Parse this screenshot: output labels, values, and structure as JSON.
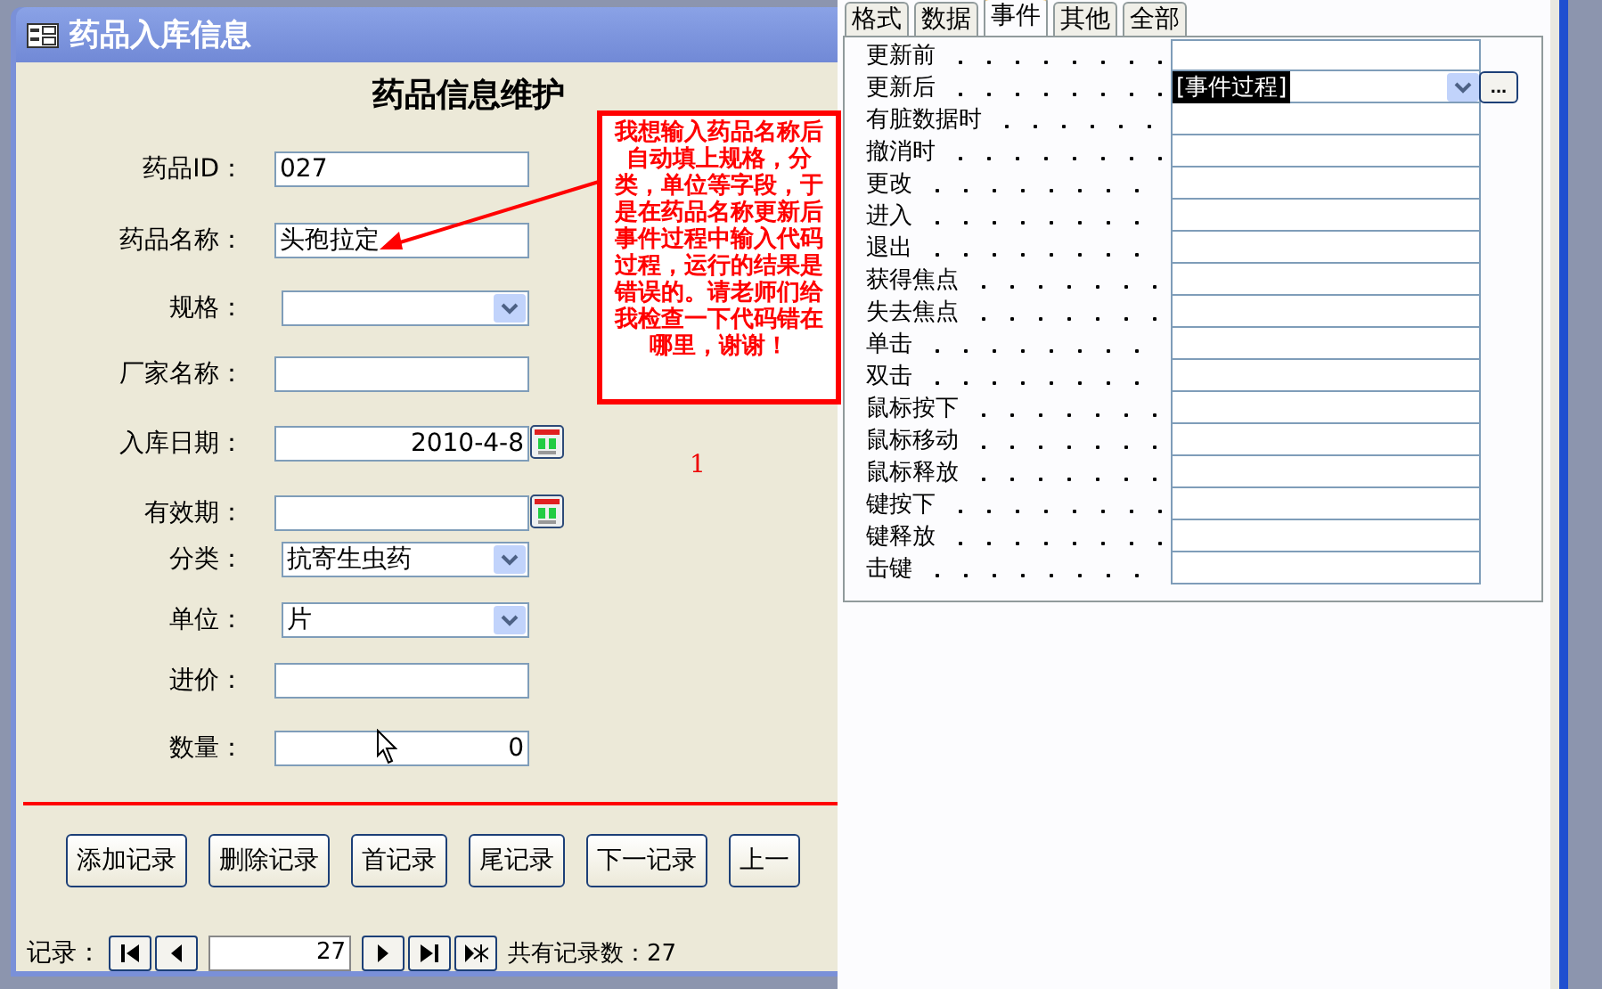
{
  "form_window": {
    "title": "药品入库信息",
    "heading": "药品信息维护",
    "fields": [
      {
        "label": "药品ID：",
        "kind": "text",
        "value": "027"
      },
      {
        "label": "药品名称：",
        "kind": "text",
        "value": "头孢拉定"
      },
      {
        "label": "规格：",
        "kind": "combo"
      },
      {
        "label": "厂家名称：",
        "kind": "text"
      },
      {
        "label": "入库日期：",
        "kind": "date",
        "value": "2010-4-8"
      },
      {
        "label": "有效期：",
        "kind": "date"
      },
      {
        "label": "分类：",
        "kind": "combo",
        "value": "抗寄生虫药"
      },
      {
        "label": "单位：",
        "kind": "combo",
        "value": "片"
      },
      {
        "label": "进价：",
        "kind": "text"
      },
      {
        "label": "数量：",
        "kind": "number",
        "value": "0"
      }
    ],
    "marker": "1",
    "buttons": [
      "添加记录",
      "删除记录",
      "首记录",
      "尾记录",
      "下一记录",
      "上一"
    ],
    "navigator": {
      "label": "记录：",
      "current": "27",
      "total": "共有记录数：27"
    }
  },
  "annotation": {
    "text": "我想输入药品名称后自动填上规格，分类，单位等字段，于是在药品名称更新后事件过程中输入代码过程，运行的结果是错误的。请老师们给我检查一下代码错在哪里，谢谢！"
  },
  "property_sheet": {
    "tabs": [
      {
        "label": "格式",
        "selected": false
      },
      {
        "label": "数据",
        "selected": false
      },
      {
        "label": "事件",
        "selected": true
      },
      {
        "label": "其他",
        "selected": false
      },
      {
        "label": "全部",
        "selected": false
      }
    ],
    "events": [
      {
        "label": "更新前",
        "selected": false
      },
      {
        "label": "更新后",
        "value": "[事件过程]",
        "builder": "...",
        "selected": true
      },
      {
        "label": "有脏数据时",
        "selected": false
      },
      {
        "label": "撤消时",
        "selected": false
      },
      {
        "label": "更改",
        "selected": false
      },
      {
        "label": "进入",
        "selected": false
      },
      {
        "label": "退出",
        "selected": false
      },
      {
        "label": "获得焦点",
        "selected": false
      },
      {
        "label": "失去焦点",
        "selected": false
      },
      {
        "label": "单击",
        "selected": false
      },
      {
        "label": "双击",
        "selected": false
      },
      {
        "label": "鼠标按下",
        "selected": false
      },
      {
        "label": "鼠标移动",
        "selected": false
      },
      {
        "label": "鼠标释放",
        "selected": false
      },
      {
        "label": "键按下",
        "selected": false
      },
      {
        "label": "键释放",
        "selected": false
      },
      {
        "label": "击键",
        "selected": false
      }
    ]
  }
}
